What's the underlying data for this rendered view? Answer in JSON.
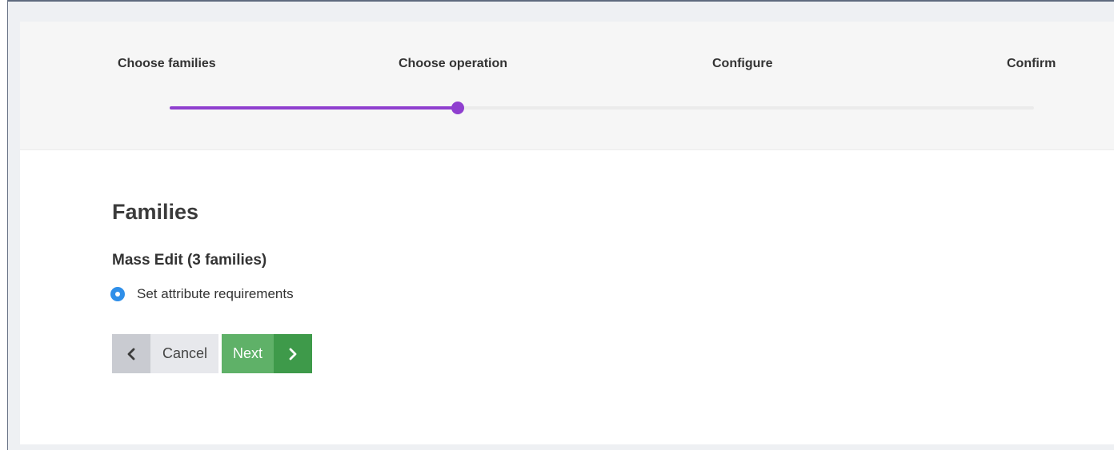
{
  "wizard": {
    "steps": [
      {
        "label": "Choose families"
      },
      {
        "label": "Choose operation"
      },
      {
        "label": "Configure"
      },
      {
        "label": "Confirm"
      }
    ],
    "current_step": 2,
    "progress_color": "#8f3fcf"
  },
  "content": {
    "title": "Families",
    "subtitle": "Mass Edit (3 families)",
    "option": {
      "label": "Set attribute requirements",
      "selected": true
    }
  },
  "buttons": {
    "cancel_label": "Cancel",
    "next_label": "Next"
  },
  "icons": {
    "back": "chevron-left-icon",
    "next": "chevron-right-icon"
  }
}
